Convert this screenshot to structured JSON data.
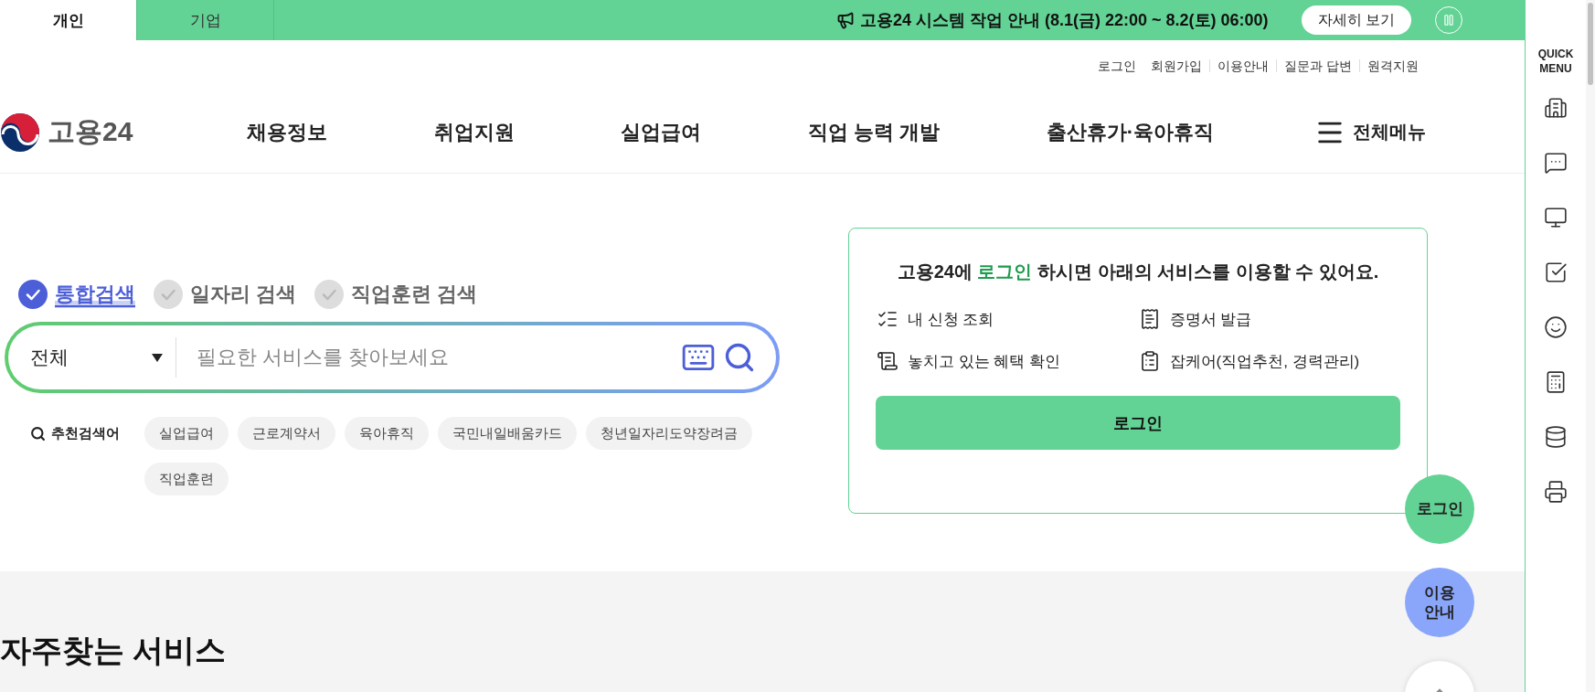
{
  "top_bar": {
    "tabs": [
      {
        "label": "개인",
        "selected": true
      },
      {
        "label": "기업",
        "selected": false
      }
    ],
    "notice": "고용24 시스템 작업 안내 (8.1(금) 22:00 ~ 8.2(토) 06:00)",
    "detail_button": "자세히 보기"
  },
  "utility_links": [
    "로그인",
    "회원가입",
    "이용안내",
    "질문과 답변",
    "원격지원"
  ],
  "header": {
    "logo_text": "고용24",
    "nav": [
      "채용정보",
      "취업지원",
      "실업급여",
      "직업 능력 개발",
      "출산휴가·육아휴직"
    ],
    "all_menu": "전체메뉴"
  },
  "search": {
    "tabs": [
      {
        "label": "통합검색",
        "selected": true
      },
      {
        "label": "일자리 검색",
        "selected": false
      },
      {
        "label": "직업훈련 검색",
        "selected": false
      }
    ],
    "category": "전체",
    "placeholder": "필요한 서비스를 찾아보세요",
    "recommended_label": "추천검색어",
    "keywords": [
      "실업급여",
      "근로계약서",
      "육아휴직",
      "국민내일배움카드",
      "청년일자리도약장려금",
      "직업훈련"
    ]
  },
  "login_card": {
    "title": [
      {
        "text": "고용24에 ",
        "highlight": false
      },
      {
        "text": "로그인",
        "highlight": true
      },
      {
        "text": " 하시면 아래의 서비스를 이용할 수 있어요.",
        "highlight": false
      }
    ],
    "services": [
      "내 신청 조회",
      "증명서 발급",
      "놓치고 있는 혜택 확인",
      "잡케어(직업추천, 경력관리)"
    ],
    "button": "로그인"
  },
  "frequent_services": {
    "title": "자주찾는 서비스"
  },
  "floating_buttons": [
    {
      "kind": "login",
      "label": "로그인"
    },
    {
      "kind": "guide",
      "label": "이용 안내"
    },
    {
      "kind": "top"
    }
  ],
  "quick_menu": {
    "title": "QUICK MENU"
  }
}
